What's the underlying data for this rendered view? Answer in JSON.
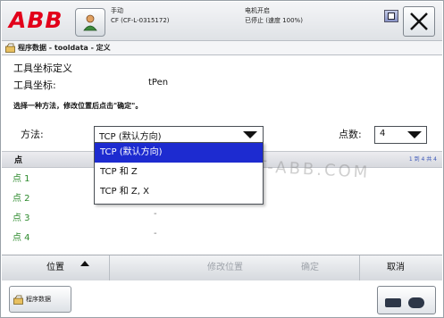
{
  "header": {
    "logo_text": "ABB",
    "status_left": [
      "手动",
      "CF (CF-L-0315172)"
    ],
    "status_right": [
      "电机开启",
      "已停止 (速度 100%)"
    ],
    "close_icon": "close-icon",
    "user_icon": "user-icon"
  },
  "breadcrumb": {
    "text": "程序数据 - tooldata - 定义"
  },
  "content": {
    "heading": "工具坐标定义",
    "tool_label": "工具坐标:",
    "tool_value": "tPen",
    "instruction": "选择一种方法，修改位置后点击\"确定\"。",
    "method_label": "方法:",
    "method_selected": "TCP (默认方向)",
    "points_label": "点数:",
    "points_selected": "4"
  },
  "method_options": [
    {
      "label": "TCP (默认方向)",
      "selected": true
    },
    {
      "label": "TCP 和 Z",
      "selected": false
    },
    {
      "label": "TCP 和 Z, X",
      "selected": false
    }
  ],
  "list": {
    "column_header": "点",
    "page_info": "1 到 4 共 4",
    "rows": [
      {
        "name": "点 1",
        "value": "-"
      },
      {
        "name": "点 2",
        "value": "-"
      },
      {
        "name": "点 3",
        "value": "-"
      },
      {
        "name": "点 4",
        "value": "-"
      }
    ]
  },
  "watermark": "WWW.ROBOT-ABB.COM",
  "commands": {
    "position": "位置",
    "modify_position": "修改位置",
    "confirm": "确定",
    "cancel": "取消"
  },
  "taskbar": {
    "tab_label": "程序数据"
  },
  "colors": {
    "abb_red": "#e2001a",
    "selection_blue": "#1d2bd0",
    "point_green": "#2e8b2e",
    "disabled_gray": "#9ea3aa"
  }
}
